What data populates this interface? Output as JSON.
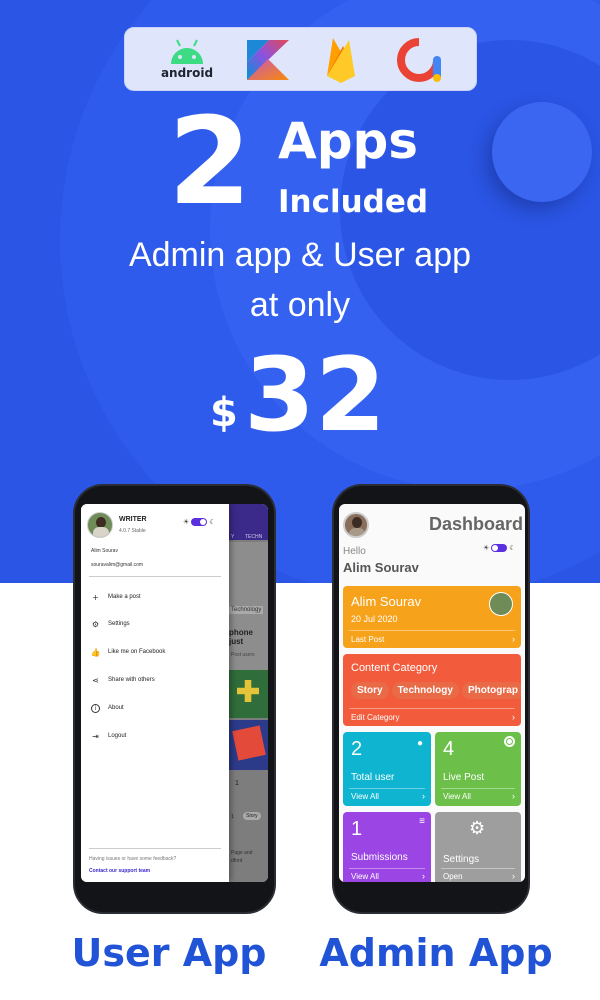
{
  "badge_logos": [
    "android-logo",
    "kotlin-logo",
    "firebase-logo",
    "admob-logo"
  ],
  "android_word": "android",
  "hero": {
    "number": "2",
    "apps": "Apps",
    "included": "Included",
    "subtitle_line1": "Admin app & User app",
    "subtitle_line2": "at only",
    "currency": "$",
    "price": "32"
  },
  "user_app": {
    "label": "User App",
    "drawer": {
      "app_name": "WRITER",
      "version": "4.0.7 Stable",
      "user_name": "Alim Sourav",
      "email": "souravalim@gmail.com",
      "menu": [
        {
          "icon": "plus-icon",
          "label": "Make a post"
        },
        {
          "icon": "gear-icon",
          "label": "Settings"
        },
        {
          "icon": "thumbs-up-icon",
          "label": "Like me on Facebook"
        },
        {
          "icon": "share-icon",
          "label": "Share with others"
        },
        {
          "icon": "info-icon",
          "label": "About"
        },
        {
          "icon": "logout-icon",
          "label": "Logout"
        }
      ],
      "feedback": "Having issues or have some feedback?",
      "contact": "Contact our support team"
    },
    "behind": {
      "tab1": "Y",
      "tab2": "TECHN",
      "tag": "Technology",
      "headline": "phone just",
      "meta": "Post users",
      "count": "1",
      "count2": "1",
      "story": "Story",
      "snippet1": "Page and",
      "snippet2": "dford"
    }
  },
  "admin_app": {
    "label": "Admin App",
    "title": "Dashboard",
    "hello": "Hello",
    "name": "Alim Sourav",
    "last_post": {
      "name": "Alim Sourav",
      "date": "20 Jul 2020",
      "footer": "Last Post"
    },
    "content_category": {
      "title": "Content Category",
      "chips": [
        "Story",
        "Technology",
        "Photograp"
      ],
      "footer": "Edit Category"
    },
    "tiles": [
      {
        "num": "2",
        "title": "Total user",
        "footer": "View All",
        "color": "#0fb5d0"
      },
      {
        "num": "4",
        "title": "Live Post",
        "footer": "View All",
        "color": "#6cc04a"
      },
      {
        "num": "1",
        "title": "Submissions",
        "footer": "View All",
        "color": "#9b45e4"
      },
      {
        "num": "",
        "title": "Settings",
        "footer": "Open",
        "color": "#9e9e9e"
      }
    ],
    "colors": {
      "last_post": "#f7a21b",
      "content_category": "#f25c3c"
    }
  },
  "colors": {
    "hero_blue": "#2a55e5",
    "label_blue": "#2153d6",
    "toggle": "#5b2fe0"
  }
}
